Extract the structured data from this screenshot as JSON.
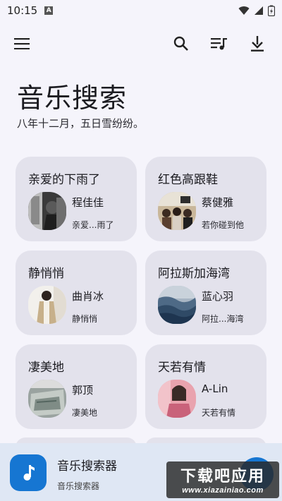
{
  "status_bar": {
    "time": "10:15",
    "indicator": "A"
  },
  "header": {
    "title": "音乐搜索",
    "subtitle": "八年十二月，五日雪纷纷。"
  },
  "cards": [
    {
      "title": "亲爱的下雨了",
      "artist": "程佳佳",
      "desc": "亲爱...雨了"
    },
    {
      "title": "红色高跟鞋",
      "artist": "蔡健雅",
      "desc": "若你碰到他"
    },
    {
      "title": "静悄悄",
      "artist": "曲肖冰",
      "desc": "静悄悄"
    },
    {
      "title": "阿拉斯加海湾",
      "artist": "蓝心羽",
      "desc": "阿拉...海湾"
    },
    {
      "title": "凄美地",
      "artist": "郭顶",
      "desc": "凄美地"
    },
    {
      "title": "天若有情",
      "artist": "A-Lin",
      "desc": "天若有情"
    }
  ],
  "player": {
    "title": "音乐搜索器",
    "subtitle": "音乐搜索器"
  },
  "watermark": {
    "main": "下载吧应用",
    "url": "www.xiazainiao.com"
  },
  "colors": {
    "background": "#f5f4fb",
    "card": "#e3e2ec",
    "player_bar": "#dfe7f4",
    "accent": "#1676d2"
  }
}
